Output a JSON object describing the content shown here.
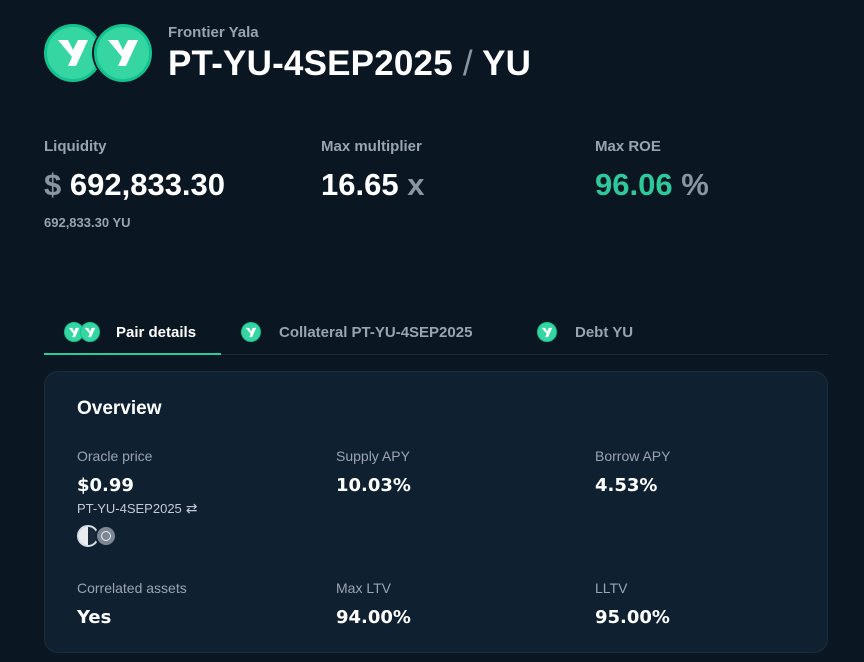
{
  "header": {
    "protocol": "Frontier Yala",
    "collateral": "PT-YU-4SEP2025",
    "separator": "/",
    "loan": "YU"
  },
  "stats": {
    "liquidity": {
      "label": "Liquidity",
      "prefix": "$",
      "value": "692,833.30",
      "sub": "692,833.30 YU"
    },
    "max_multiplier": {
      "label": "Max multiplier",
      "value": "16.65",
      "unit": "x"
    },
    "max_roe": {
      "label": "Max ROE",
      "value": "96.06",
      "unit": "%"
    }
  },
  "tabs": [
    {
      "label": "Pair details",
      "active": true
    },
    {
      "label": "Collateral PT-YU-4SEP2025",
      "active": false
    },
    {
      "label": "Debt YU",
      "active": false
    }
  ],
  "overview": {
    "title": "Overview",
    "oracle_price": {
      "label": "Oracle price",
      "value": "$0.99",
      "sub": "PT-YU-4SEP2025"
    },
    "supply_apy": {
      "label": "Supply APY",
      "value": "10.03%"
    },
    "borrow_apy": {
      "label": "Borrow APY",
      "value": "4.53%"
    },
    "correlated_assets": {
      "label": "Correlated assets",
      "value": "Yes"
    },
    "max_ltv": {
      "label": "Max LTV",
      "value": "94.00%"
    },
    "lltv": {
      "label": "LLTV",
      "value": "95.00%"
    }
  },
  "colors": {
    "accent": "#2ec99a",
    "background": "#0b1623",
    "panel": "#0f2031"
  }
}
